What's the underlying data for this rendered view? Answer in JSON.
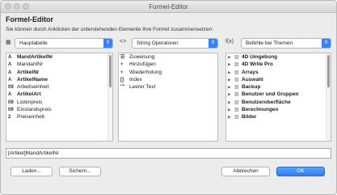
{
  "window": {
    "title": "Formel-Editor"
  },
  "heading": "Formel-Editor",
  "instruction": "Sie können durch Anklicken der unterstehenden Elemente Ihre Formel zusammensetzen:",
  "table_select": {
    "icon": "table-icon",
    "value": "Hauptabelle"
  },
  "operator_select": {
    "prefix": "<>",
    "value": "String Operatoren"
  },
  "command_select": {
    "prefix": "f(x)",
    "value": "Befehle bei Themen"
  },
  "fields": [
    {
      "icon": "A",
      "label": "MandArtikelNr",
      "bold": true
    },
    {
      "icon": "A",
      "label": "MandantNr",
      "bold": false
    },
    {
      "icon": "A",
      "label": "ArtikelNr",
      "bold": true
    },
    {
      "icon": "A",
      "label": "ArtikelName",
      "bold": true
    },
    {
      "icon": "09",
      "label": "Arbeitseinheit",
      "bold": false
    },
    {
      "icon": "A",
      "label": "ArtikelArt",
      "bold": true
    },
    {
      "icon": "09",
      "label": "Listenpreis",
      "bold": false
    },
    {
      "icon": "09",
      "label": "Einstandspreis",
      "bold": false
    },
    {
      "icon": "2",
      "label": "Preiseinheit",
      "bold": false
    }
  ],
  "operators": [
    {
      "icon": "list-icon",
      "glyph": "☰",
      "label": "Zuweisung"
    },
    {
      "icon": "plus-icon",
      "glyph": "+",
      "label": "Hinzufügen"
    },
    {
      "icon": "plus-icon",
      "glyph": "+",
      "label": "Wiederholung"
    },
    {
      "icon": "brackets-icon",
      "glyph": "[]",
      "label": "Index"
    },
    {
      "icon": "quotes-icon",
      "glyph": "\"\"",
      "label": "Leerer Text"
    }
  ],
  "commands": [
    {
      "label": "4D Umgebung",
      "bold": true
    },
    {
      "label": "4D Write Pro",
      "bold": true
    },
    {
      "label": "Arrays",
      "bold": true
    },
    {
      "label": "Auswahl",
      "bold": true
    },
    {
      "label": "Backup",
      "bold": true
    },
    {
      "label": "Benutzer und Gruppen",
      "bold": true
    },
    {
      "label": "Benutzeroberfläche",
      "bold": true
    },
    {
      "label": "Berechnungen",
      "bold": true
    },
    {
      "label": "Bilder",
      "bold": true
    }
  ],
  "formula_value": "[Artikel]MandArtikelNr",
  "buttons": {
    "load": "Laden...",
    "save": "Sichern...",
    "cancel": "Abbrechen",
    "ok": "OK"
  },
  "colors": {
    "accent": "#3b82f6"
  }
}
